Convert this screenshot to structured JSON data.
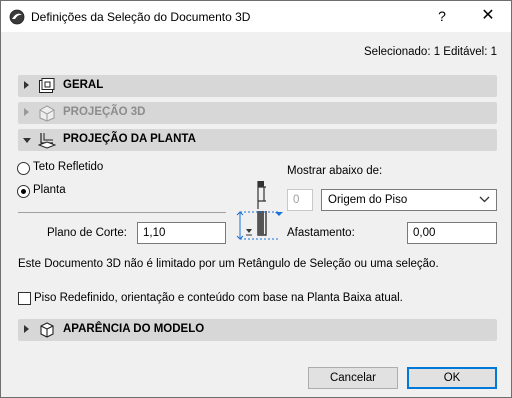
{
  "window": {
    "title": "Definições da Seleção do Documento 3D",
    "help_glyph": "?",
    "close_glyph": "✕"
  },
  "selected_info": "Selecionado: 1 Editável: 1",
  "sections": {
    "geral": {
      "label": "GERAL",
      "expanded": false
    },
    "projecao_3d": {
      "label": "PROJEÇÃO 3D",
      "expanded": false,
      "disabled": true
    },
    "projecao_planta": {
      "label": "PROJEÇÃO DA PLANTA",
      "expanded": true
    },
    "aparencia": {
      "label": "APARÊNCIA DO MODELO",
      "expanded": false
    }
  },
  "planta_section": {
    "radio_teto": {
      "label": "Teto Refletido",
      "checked": false
    },
    "radio_planta": {
      "label": "Planta",
      "checked": true
    },
    "plano_corte_label": "Plano de Corte:",
    "plano_corte_value": "1,10",
    "mostrar_label": "Mostrar abaixo de:",
    "story_value": "0",
    "origem_select": "Origem do Piso",
    "afastamento_label": "Afastamento:",
    "afastamento_value": "0,00",
    "info_text": "Este Documento 3D não é limitado por um Retângulo de Seleção ou uma seleção.",
    "piso_checkbox": {
      "label": "Piso Redefinido, orientação e conteúdo com base na Planta Baixa atual.",
      "checked": false
    }
  },
  "buttons": {
    "cancel": "Cancelar",
    "ok": "OK"
  },
  "colors": {
    "section_bar": "#d7d7d7",
    "accent_blue": "#0078d7",
    "diagram_blue": "#1a73d9"
  }
}
